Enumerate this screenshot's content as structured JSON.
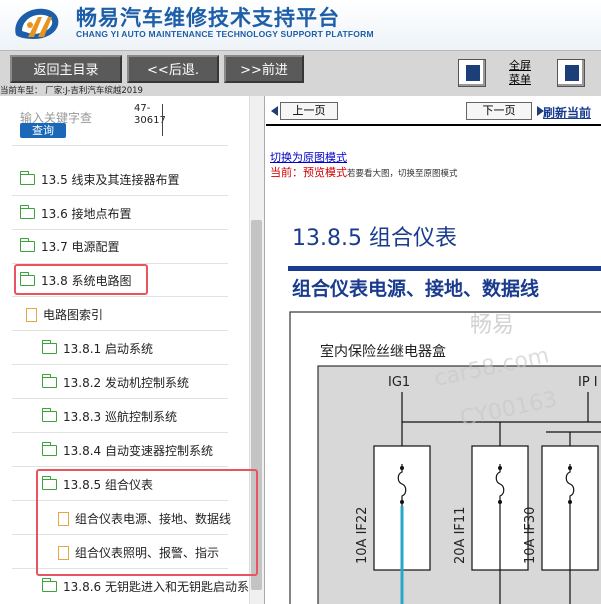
{
  "header": {
    "title_cn": "畅易汽车维修技术支持平台",
    "title_en": "CHANG YI AUTO MAINTENANCE TECHNOLOGY SUPPORT PLATFORM",
    "brand_color": "#1d5ea8"
  },
  "toolbar": {
    "home_label": "返回主目录",
    "back_label": "<<后退.",
    "forward_label": ">>前进",
    "fullscreen_line1": "全屏",
    "fullscreen_line2": "菜单",
    "car_info": "当前车型：  厂家:J-吉利汽车缤越2019"
  },
  "search": {
    "placeholder": "输入关键字查",
    "button_label": "查询",
    "number_line1": "47-",
    "number_line2": "30617"
  },
  "tree": {
    "items": [
      {
        "label": "13.5 线束及其连接器布置",
        "icon": "folder-icon"
      },
      {
        "label": "13.6 接地点布置",
        "icon": "folder-icon"
      },
      {
        "label": "13.7 电源配置",
        "icon": "folder-icon"
      },
      {
        "label": "13.8 系统电路图",
        "icon": "folder-open-icon"
      },
      {
        "label": "电路图索引",
        "icon": "document-icon"
      },
      {
        "label": "13.8.1 启动系统",
        "icon": "folder-icon"
      },
      {
        "label": "13.8.2 发动机控制系统",
        "icon": "folder-icon"
      },
      {
        "label": "13.8.3 巡航控制系统",
        "icon": "folder-icon"
      },
      {
        "label": "13.8.4 自动变速器控制系统",
        "icon": "folder-icon"
      },
      {
        "label": "13.8.5 组合仪表",
        "icon": "folder-open-icon"
      },
      {
        "label": "组合仪表电源、接地、数据线",
        "icon": "document-icon"
      },
      {
        "label": "组合仪表照明、报警、指示",
        "icon": "document-icon"
      },
      {
        "label": "13.8.6 无钥匙进入和无钥匙启动系",
        "icon": "folder-icon"
      }
    ],
    "highlight_color": "#e8555f"
  },
  "content": {
    "prev_label": "上一页",
    "next_label": "下一页",
    "refresh_label": "刷新当前",
    "switch_link": "切换为原图模式",
    "current_label": "当前：",
    "current_mode": "预览模式",
    "current_hint": "若要看大图，切换至原图模式",
    "page_title": "13.8.5 组合仪表",
    "sub_title": "组合仪表电源、接地、数据线",
    "diagram": {
      "box_title": "室内保险丝继电器盒",
      "feed_left": "IG1",
      "feed_right": "IP I",
      "fuses": [
        "10A IF22",
        "20A IF11",
        "10A IF30"
      ],
      "watermark": [
        "畅易",
        "car58.com",
        "CY00163"
      ]
    },
    "title_color": "#1a3c8f"
  }
}
